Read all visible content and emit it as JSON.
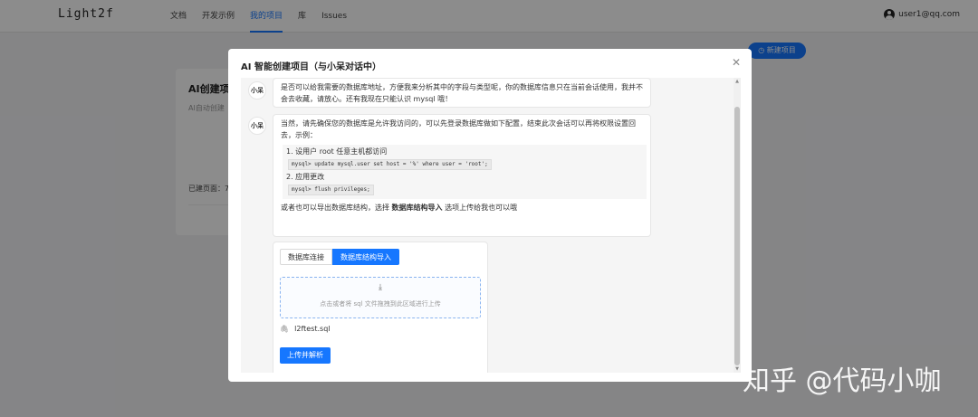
{
  "app": {
    "brand": "Light2f",
    "nav": [
      "文档",
      "开发示例",
      "我的项目",
      "库",
      "Issues"
    ],
    "active_nav": "我的项目",
    "user_email": "user1@qq.com",
    "new_project_button": "新建项目"
  },
  "background_card": {
    "title": "AI创建项目",
    "subtitle": "AI自动创建",
    "meta": "已建页面：7"
  },
  "modal": {
    "title": "AI 智能创建项目（与小呆对话中）",
    "messages": [
      {
        "sender": "小呆",
        "text": "是否可以给我需要的数据库地址，方便我来分析其中的字段与类型呢，你的数据库信息只在当前会话使用，我并不会去收藏，请放心。还有我现在只能认识 mysql 哦！"
      },
      {
        "sender": "小呆",
        "intro": "当然，请先确保您的数据库是允许我访问的，可以先登录数据库做如下配置，结束此次会话可以再将权限设置回去，示例：",
        "step1": "1. 设用户 root 任意主机都访问",
        "code1": "mysql> update mysql.user set host = '%' where user = 'root';",
        "step2": "2. 应用更改",
        "code2": "mysql> flush privileges;",
        "after_prefix": "或者也可以导出数据库结构，选择 ",
        "after_bold": "数据库结构导入",
        "after_suffix": " 选项上传给我也可以哦"
      }
    ],
    "upload": {
      "tabs": [
        "数据库连接",
        "数据库结构导入"
      ],
      "active_tab": "数据库结构导入",
      "dropzone_text": "点击或者将 sql 文件拖拽到此区域进行上传",
      "file_name": "l2ftest.sql",
      "submit_label": "上传并解析"
    }
  },
  "watermark": "知乎 @代码小咖",
  "colors": {
    "primary": "#1677ff",
    "overlay": "rgba(0,0,0,0.45)"
  }
}
